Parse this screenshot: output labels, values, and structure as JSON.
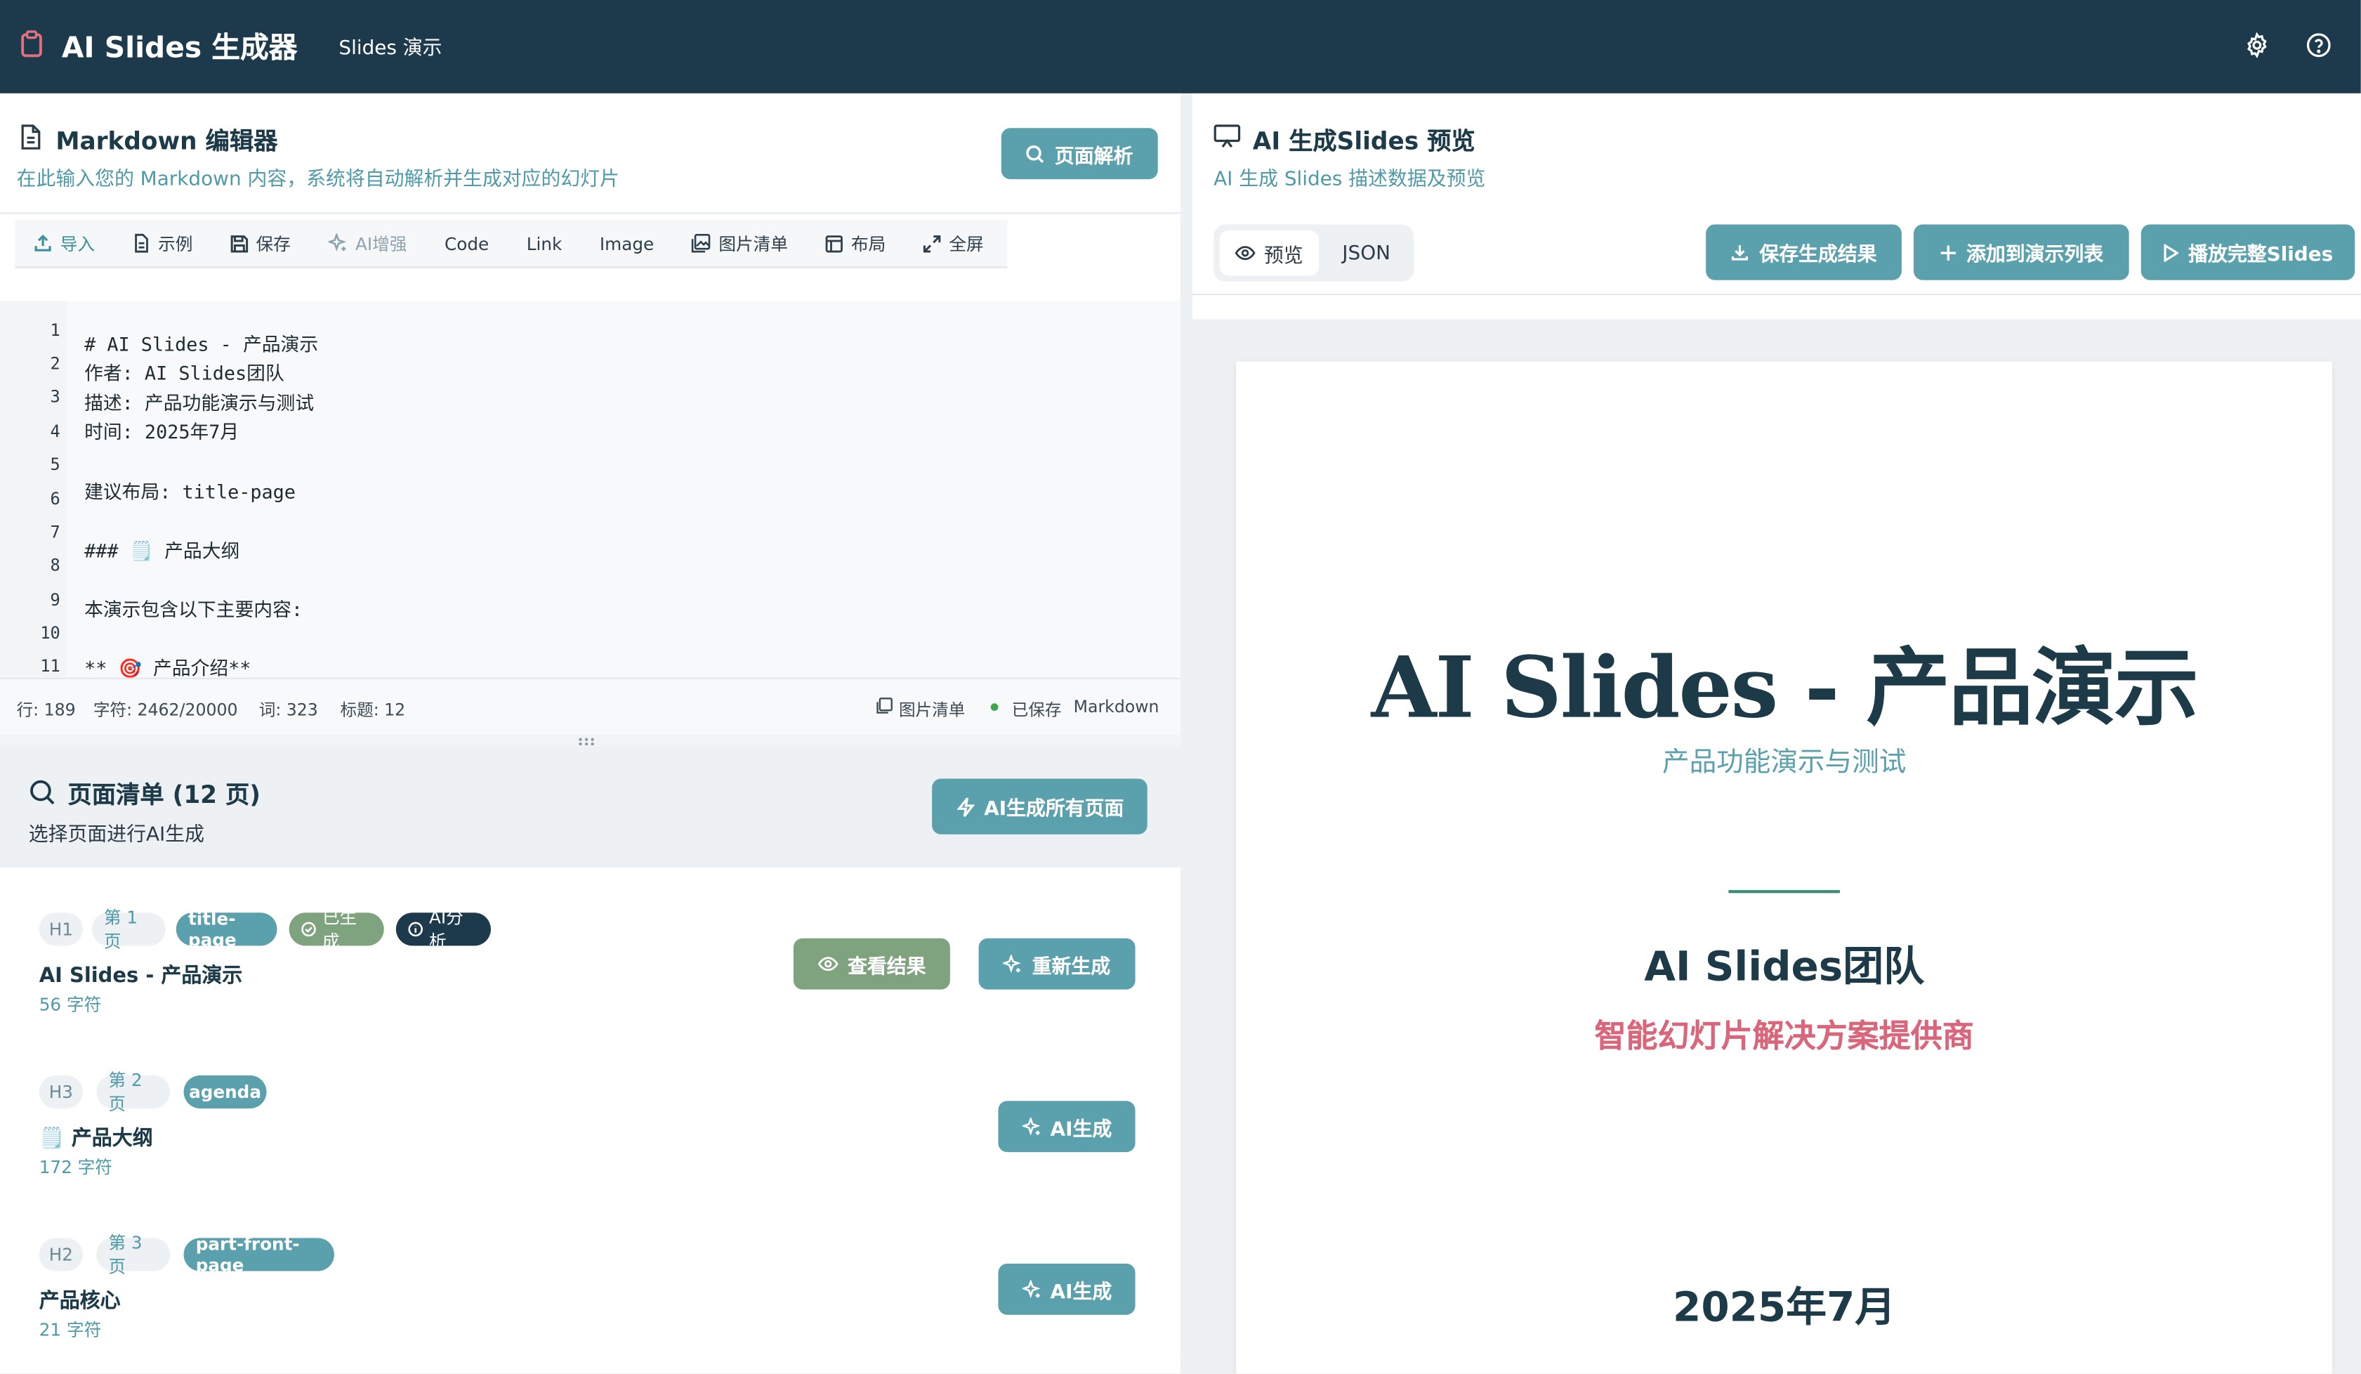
{
  "header": {
    "app_title": "AI Slides 生成器",
    "nav_link": "Slides 演示"
  },
  "editor": {
    "title": "Markdown 编辑器",
    "subtitle": "在此输入您的 Markdown 内容，系统将自动解析并生成对应的幻灯片",
    "parse_button": "页面解析",
    "toolbar": {
      "import": "导入",
      "example": "示例",
      "save": "保存",
      "ai_enhance": "AI增强",
      "code": "Code",
      "link": "Link",
      "image": "Image",
      "image_list": "图片清单",
      "layout": "布局",
      "fullscreen": "全屏"
    },
    "lines": [
      {
        "num": "1",
        "text": ""
      },
      {
        "num": "2",
        "text": "# AI Slides - 产品演示"
      },
      {
        "num": "3",
        "text": "作者: AI Slides团队"
      },
      {
        "num": "4",
        "text": "描述: 产品功能演示与测试"
      },
      {
        "num": "5",
        "text": "时间: 2025年7月"
      },
      {
        "num": "6",
        "text": ""
      },
      {
        "num": "7",
        "text": "建议布局: title-page"
      },
      {
        "num": "8",
        "text": ""
      },
      {
        "num": "9",
        "text": "### 🗒️ 产品大纲"
      },
      {
        "num": "10",
        "text": ""
      },
      {
        "num": "11",
        "text": "本演示包含以下主要内容:"
      },
      {
        "num": "",
        "text": ""
      },
      {
        "num": "",
        "text": "** 🎯 产品介绍**"
      }
    ],
    "status": {
      "line": "行: 189",
      "chars": "字符: 2462/20000",
      "words": "词: 323",
      "headings": "标题: 12",
      "image_list": "图片清单",
      "saved": "已保存",
      "format": "Markdown"
    }
  },
  "page_list": {
    "title": "页面清单 (12 页)",
    "subtitle": "选择页面进行AI生成",
    "generate_all": "AI生成所有页面",
    "items": [
      {
        "level": "H1",
        "page": "第 1 页",
        "layout": "title-page",
        "status": "已生成",
        "ai_tag": "AI分析",
        "title": "AI Slides - 产品演示",
        "chars": "56 字符",
        "view_button": "查看结果",
        "regen_button": "重新生成"
      },
      {
        "level": "H3",
        "page": "第 2 页",
        "layout": "agenda",
        "title": "🗒️ 产品大纲",
        "chars": "172 字符",
        "gen_button": "AI生成"
      },
      {
        "level": "H2",
        "page": "第 3 页",
        "layout": "part-front-page",
        "title": "产品核心",
        "chars": "21 字符",
        "gen_button": "AI生成"
      }
    ]
  },
  "preview": {
    "title": "AI 生成Slides 预览",
    "subtitle": "AI 生成 Slides 描述数据及预览",
    "tab_preview": "预览",
    "tab_json": "JSON",
    "save_button": "保存生成结果",
    "add_button": "添加到演示列表",
    "play_button": "播放完整Slides"
  },
  "slide": {
    "title": "AI Slides - 产品演示",
    "subtitle": "产品功能演示与测试",
    "team": "AI Slides团队",
    "tagline": "智能幻灯片解决方案提供商",
    "date": "2025年7月"
  },
  "colors": {
    "header_bg": "#1c3a4c",
    "accent": "#5aa0ad",
    "success": "#7fa37f",
    "highlight": "#d9667a"
  }
}
